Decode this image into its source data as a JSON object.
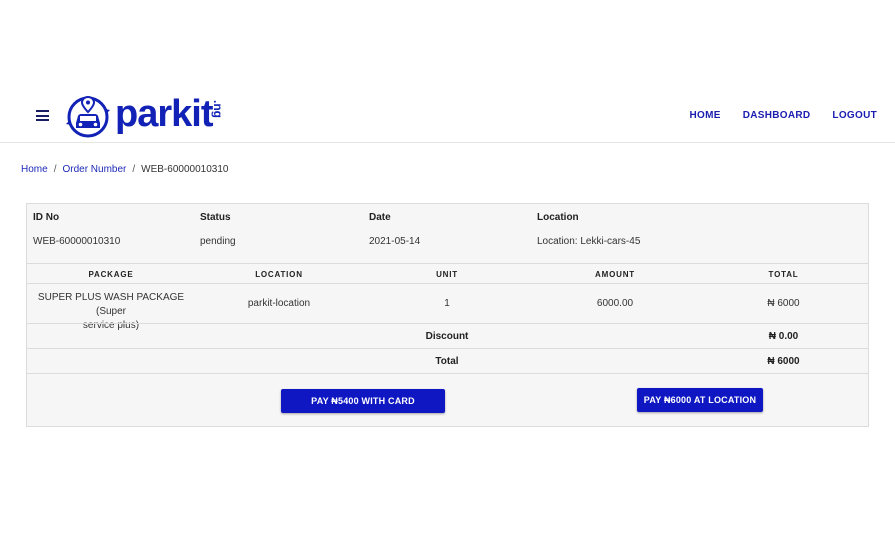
{
  "header": {
    "logo_text": "parkit",
    "logo_suffix": ".ng",
    "nav": [
      "HOME",
      "DASHBOARD",
      "LOGOUT"
    ]
  },
  "breadcrumb": [
    "Home",
    "Order Number",
    "WEB-60000010310"
  ],
  "order": {
    "headers": [
      "ID No",
      "Status",
      "Date",
      "Location"
    ],
    "values": [
      "WEB-60000010310",
      "pending",
      "2021-05-14",
      "Location: Lekki-cars-45"
    ]
  },
  "table": {
    "columns": [
      "PACKAGE",
      "LOCATION",
      "UNIT",
      "AMOUNT",
      "TOTAL"
    ],
    "rows": [
      {
        "package_line1": "SUPER PLUS WASH PACKAGE (Super",
        "package_line2": "service plus)",
        "location": "parkit-location",
        "unit": "1",
        "amount": "6000.00",
        "total": "₦ 6000"
      }
    ],
    "discount_label": "Discount",
    "discount_value": "₦ 0.00",
    "total_label": "Total",
    "total_value": "₦ 6000"
  },
  "buttons": {
    "pay_card": "PAY ₦5400 WITH CARD",
    "pay_location": "PAY ₦6000 AT LOCATION"
  },
  "colors": {
    "brand": "#1322b6",
    "button": "#0f17c2",
    "link": "#1e2ab8"
  }
}
